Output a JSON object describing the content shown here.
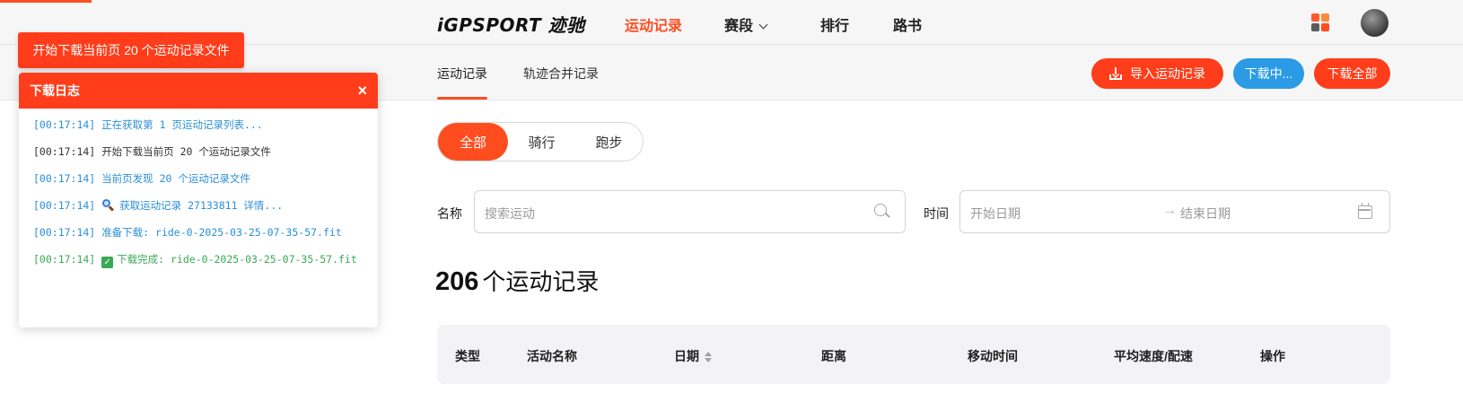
{
  "header": {
    "logo": "iGPSPORT 迹驰",
    "nav": [
      {
        "label": "运动记录",
        "active": true
      },
      {
        "label": "赛段",
        "has_dropdown": true
      },
      {
        "label": "排行"
      },
      {
        "label": "路书"
      }
    ],
    "apps_icon": "apps-grid-icon",
    "avatar_icon": "user-avatar"
  },
  "subnav": {
    "tabs": [
      {
        "label": "运动记录",
        "active": true
      },
      {
        "label": "轨迹合并记录"
      }
    ],
    "buttons": {
      "import": "导入运动记录",
      "downloading": "下载中...",
      "download_all": "下载全部"
    }
  },
  "filters": {
    "sport_types": [
      "全部",
      "骑行",
      "跑步"
    ],
    "selected_sport": "全部",
    "name_label": "名称",
    "name_placeholder": "搜索运动",
    "time_label": "时间",
    "start_placeholder": "开始日期",
    "end_placeholder": "结束日期"
  },
  "summary": {
    "count": "206",
    "count_suffix": "个运动记录"
  },
  "table": {
    "columns": [
      "类型",
      "活动名称",
      "日期",
      "距离",
      "移动时间",
      "平均速度/配速",
      "操作"
    ],
    "sortable_column": "日期"
  },
  "toast": {
    "message": "开始下载当前页 20 个运动记录文件"
  },
  "download_log": {
    "title": "下载日志",
    "close": "×",
    "entries": [
      {
        "time": "[00:17:14]",
        "text": "正在获取第 1 页运动记录列表...",
        "color": "#2a8fd8"
      },
      {
        "time": "[00:17:14]",
        "text": "开始下载当前页 20 个运动记录文件",
        "color": "#333333"
      },
      {
        "time": "[00:17:14]",
        "text": "当前页发现 20 个运动记录文件",
        "color": "#2a8fd8"
      },
      {
        "time": "[00:17:14]",
        "text": "获取运动记录 27133811 详情...",
        "color": "#2a8fd8",
        "icon": "magnifier-icon"
      },
      {
        "time": "[00:17:14]",
        "text": "准备下载: ride-0-2025-03-25-07-35-57.fit",
        "color": "#2a8fd8"
      },
      {
        "time": "[00:17:14]",
        "text": "下载完成: ride-0-2025-03-25-07-35-57.fit",
        "color": "#3aa856",
        "icon": "check-mark-icon"
      }
    ]
  },
  "colors": {
    "accent": "#ff4d1f",
    "info_blue": "#2b9be6",
    "success_green": "#3aa856"
  }
}
